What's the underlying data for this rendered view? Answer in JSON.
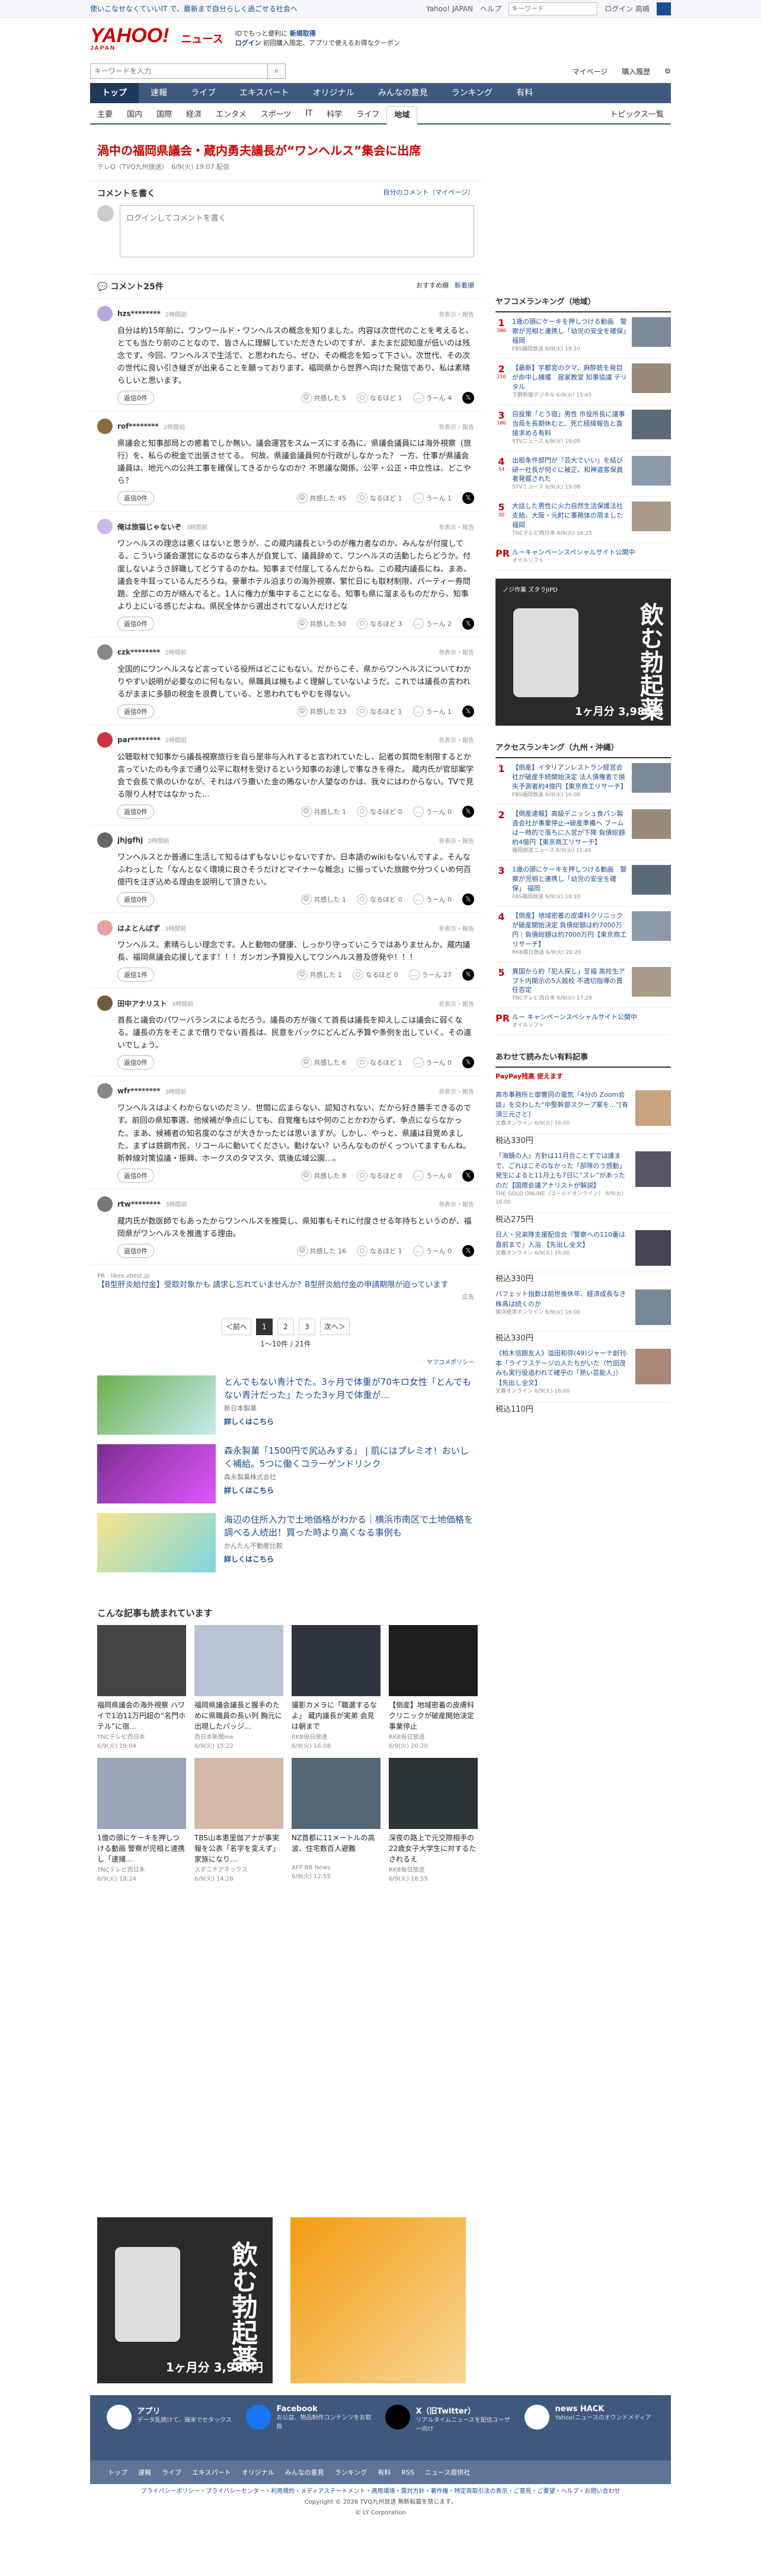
{
  "topbar": {
    "tagline": "使いこなせなくていいIT で、最新まで自分らしく過ごせる社会へ",
    "links": [
      "Yahoo! JAPAN",
      "ヘルプ"
    ],
    "search_placeholder": "キーワード",
    "login": "ログイン 高嶋"
  },
  "header": {
    "logo": "YAHOO!",
    "logo_sub": "JAPAN",
    "section": "ニュース",
    "promo_line1": "IDでもっと便利に",
    "promo_new": "新規取得",
    "promo_line2": "ログイン",
    "promo_line3": "初回購入限定、アプリで使えるお得なクーポン"
  },
  "search": {
    "placeholder": "キーワードを入力",
    "links": [
      "マイページ",
      "購入履歴"
    ]
  },
  "nav": {
    "items": [
      "トップ",
      "速報",
      "ライブ",
      "エキスパート",
      "オリジナル",
      "みんなの意見",
      "ランキング",
      "有料"
    ],
    "active": 0
  },
  "subnav": {
    "items": [
      "主要",
      "国内",
      "国際",
      "経済",
      "エンタメ",
      "スポーツ",
      "IT",
      "科学",
      "ライフ",
      "地域"
    ],
    "active": 9,
    "topics": "トピックス一覧"
  },
  "article": {
    "title": "渦中の福岡県議会・蔵内勇夫議長が“ワンヘルス”集会に出席",
    "source": "テレQ（TVQ九州放送）",
    "date": "6/9(火) 19:07 配信"
  },
  "comment_box": {
    "title": "コメントを書く",
    "link": "自分のコメント（マイページ）",
    "placeholder": "ログインしてコメントを書く"
  },
  "comments_header": {
    "title": "コメント25件",
    "sort": [
      "おすすめ順",
      "新着順"
    ]
  },
  "comments": [
    {
      "name": "hzs********",
      "time": "2時間前",
      "report": "非表示・報告",
      "text": "自分は約15年前に、ワンワールド・ワンヘルスの概念を知りました。内容は次世代のことを考えると、とても当たり前のことなので、皆さんに理解していただきたいのですが、またまだ認知度が低いのは残念です。今回、ワンヘルスで生活で、と思われたら、ぜひ、その概念を知って下さい。次世代、その次の世代に良い引き継ぎが出来ることを願っております。福岡県から世界へ向けた発信であり、私は素晴らしいと思います。",
      "reply": "返信0件",
      "v1": "共感した 5",
      "v2": "なるほど 1",
      "v3": "うーん 4",
      "color": "#b6a6d9"
    },
    {
      "name": "rof********",
      "time": "2時間前",
      "report": "非表示・報告",
      "text": "県議会と知事部局との癒着でしか無い。議会運営をスムーズにする為に、県議会議員には海外視察（旅行）を、私らの税金で出張させてる。 何故、県議会議員何か行政がしなかった？ 一方、仕事が県議会議員は、地元への公共工事を確保してきるからなのか？不思議な関係。公平・公正・中立性は、どこやら？",
      "reply": "返信0件",
      "v1": "共感した 45",
      "v2": "なるほど 1",
      "v3": "うーん 1",
      "color": "#8a6d3b"
    },
    {
      "name": "俺は旅猫じゃないぞ",
      "time": "3時間前",
      "report": "非表示・報告",
      "text": "ワンヘルスの理念は悪くはないと思うが、この蔵内議長というのが権力者なのか、みんなが付度してる。こういう議会運営になるのなら本人が自覚して、議員辞めて、ワンヘルスの活動したらどうか。付度しないようさ辞職してどうするのかね。知事まで付度してるんだからね。この蔵内議長にね、まあ、議会を牛耳っているんだろうね。豪華ホテル泊まりの海外視察、繁忙日にも取材制限、パーティー券問題、全部この方が絡んでると。1人に権力が集中することになる。知事も県に溜まるものだから、知事より上にいる感じだよね。県民全体から選出されてない人だけどな",
      "reply": "返信0件",
      "v1": "共感した 50",
      "v2": "なるほど 3",
      "v3": "うーん 2",
      "color": "#c9b9e8"
    },
    {
      "name": "czk********",
      "time": "2時間前",
      "report": "非表示・報告",
      "text": "全国的にワンヘルスなど言っている役所はどこにもない。だからこそ、県からワンヘルスについてわかりやすい説明が必要なのに何もない。県職員は機もよく理解していないようだ。これでは議長の言われるがままに多額の税金を浪費している、と思われてもやむを得ない。",
      "reply": "返信0件",
      "v1": "共感した 23",
      "v2": "なるほど 1",
      "v3": "うーん 1",
      "color": "#888"
    },
    {
      "name": "par********",
      "time": "2時間前",
      "report": "非表示・報告",
      "text": "公聴取材で知事から議長視察旅行を自ら是非与入れすると言われていたし、記者の質問を制限するとか言っていたのも今まで通り公平に取材を受けるという知事のお達しで事なきを得た。 蔵内氏が官邸案学会で会長で県のいかなが、それはバラ撒いた金の賄ないか人望なのかは、我々にはわからない。TVで見る限り人材ではなかった...",
      "reply": "返信0件",
      "v1": "共感した 1",
      "v2": "なるほど 0",
      "v3": "うーん 0",
      "color": "#c34"
    },
    {
      "name": "jhjgfhj",
      "time": "2時間前",
      "report": "非表示・報告",
      "text": "ワンヘルスとか普通に生活して知るはずもないじゃないですか。日本語のwikiもないんですよ。そんなふわっとした「なんとなく環境に良さそうだけどマイナーな概念」に振っていた旅館や分つくいめ何百億円を注ぎ込める理由を説明して頂きたい。",
      "reply": "返信0件",
      "v1": "共感した 1",
      "v2": "なるほど 0",
      "v3": "うーん 0",
      "color": "#666"
    },
    {
      "name": "はよとんばず",
      "time": "3時間前",
      "report": "非表示・報告",
      "text": "ワンヘルス。素晴らしい理念です。人と動物の健康、しっかり守っていこうではありませんか。蔵内議長、福岡県議会応援してます！！！ガンガン予算投入してワンヘルス普及啓発や！！！",
      "reply": "返信1件",
      "v1": "共感した 1",
      "v2": "なるほど 0",
      "v3": "うーん 27",
      "color": "#e8a0a0"
    },
    {
      "name": "田中アナリスト",
      "time": "3時間前",
      "report": "非表示・報告",
      "text": "首長と議会のパワーバランスによるだろう。議長の方が強くて首長は議長を抑えしこは議会に弱くなる。議長の方をそこまで借りでない首長は、民意をバックにどんどん予算や条例を出していく。その違いでしょう。",
      "reply": "返信0件",
      "v1": "共感した 6",
      "v2": "なるほど 1",
      "v3": "うーん 0",
      "color": "#6f5b3e"
    },
    {
      "name": "wfr********",
      "time": "3時間前",
      "report": "非表示・報告",
      "text": "ワンヘルスはよくわからないのだミソ、世間に広まらない、認知されない、だから好き勝手できるのです。前回の県知事選、他候補が争点にしても、自覚権もはや何のことかわからず、争点にならなかった。まあ、候補者の知名度のなさが大きかったとは思いますが。しかし、やっと、県議は目覚めました。まずは鉄鋼市民、リコールに動いてください。動けない？いろんなものがくっついてますもんね。新幹線対策協議・振興、ホークスのタマスタ、筑後広域公園…。",
      "reply": "返信0件",
      "v1": "共感した 8",
      "v2": "なるほど 0",
      "v3": "うーん 0",
      "color": "#888"
    },
    {
      "name": "rtw********",
      "time": "3時間前",
      "report": "非表示・報告",
      "text": "蔵内氏が数医師でもあったからワンヘルスを推奨し、県知事もそれに付度させる年持ちというのが、福岡県がワンヘルスを推進する理由。",
      "reply": "返信0件",
      "v1": "共感した 16",
      "v2": "なるほど 1",
      "v3": "うーん 0",
      "color": "#777"
    }
  ],
  "pr_note": {
    "label": "PR",
    "source": "likes.vbest.jp",
    "text": "【B型肝炎給付金】受取対象かも 請求し忘れていませんか？B型肝炎給付金の申請期限が迫っています",
    "tag": "広告"
  },
  "pager": {
    "prev": "＜前へ",
    "pages": [
      "1",
      "2",
      "3"
    ],
    "next": "次へ＞",
    "info": "1〜10件 / 21件",
    "policy": "ヤフコメポリシー"
  },
  "ads": [
    {
      "title": "とんでもない青汁でた。3ヶ月で体重が70キロ女性「とんでもない青汁だった」たった3ヶ月で体重が...",
      "sub": "新日本製薬",
      "detail": "詳しくはこちら"
    },
    {
      "title": "森永製菓「1500円で尻込みする」 | 肌にはプレミオ！おいしく補給。5つに働くコラーゲンドリンク",
      "sub": "森永製菓株式会社",
      "detail": "詳しくはこちら"
    },
    {
      "title": "海辺の住所入力で土地価格がわかる｜横浜市南区で土地価格を調べる人続出！買った時より高くなる事例も",
      "sub": "かんたん不動産比較",
      "detail": "詳しくはこちら"
    }
  ],
  "more": {
    "title": "こんな記事も読まれています",
    "items": [
      {
        "title": "福岡県議会の海外視察 ハワイで1泊11万円超の“名門ホテル”に宿…",
        "src": "TNCテレビ西日本",
        "time": "6/9(火) 19:04"
      },
      {
        "title": "福岡県議会議長と握手のために県職員の長い列 胸元に出現したパッジ…",
        "src": "西日本新聞me",
        "time": "6/9(火) 15:22"
      },
      {
        "title": "撮影カメラに「職選するなよ」 蔵内議長が実弟 会見は朝まで",
        "src": "RKB毎日放送",
        "time": "6/9(火) 16:08"
      },
      {
        "title": "【倒産】地域密着の皮膚科クリニックが破産開始決定 事業停止",
        "src": "RKB毎日放送",
        "time": "6/9(火) 20:20"
      },
      {
        "title": "1億の頭にケーキを押しつける動画 警察が児相と連携し「逮捕…",
        "src": "TNCテレビ西日本",
        "time": "6/9(火) 18:24"
      },
      {
        "title": "TBS山本恵里伽アナが事実報を公表「名字を変えず」家族になり…",
        "src": "スポニチアネックス",
        "time": "6/9(火) 14:26"
      },
      {
        "title": "NZ首都に11メートルの高波、住宅数百人避難",
        "src": "AFP BB News",
        "time": "6/9(火) 12:55"
      },
      {
        "title": "深夜の路上で元交際相手の22歳女子大学生に対するたされるえ",
        "src": "RKB毎日放送",
        "time": "6/9(火) 18:55"
      }
    ]
  },
  "ranking": {
    "title": "ヤフコメランキング（地域）",
    "items": [
      {
        "n": "1",
        "c": "386",
        "title": "1歳の頭にケーキを押しつける動画　警察が児相と連携し「幼児の安全を確保」福岡",
        "src": "FBS福岡放送 6/9(火) 18:10"
      },
      {
        "n": "2",
        "c": "210",
        "title": "【最新】宇都宮のクマ、麻酔銃を発目が命中し捕獲　居家教堂 知事協議 デリタル",
        "src": "下野新聞デジタル 6/9(火) 15:45"
      },
      {
        "n": "3",
        "c": "186",
        "title": "自投策「とう宿」男性 市役所長に議事当局を長期休むと、死亡経緯報告と直接求める有料",
        "src": "STVニュース 6/9(火) 19:05"
      },
      {
        "n": "4",
        "c": "54",
        "title": "出租条件部門が「芸大でいい」を結び研一社長が何ぐに被正、和神道客保員者発掘された",
        "src": "STVニュース 6/9(火) 19:08"
      },
      {
        "n": "5",
        "c": "30",
        "title": "大話した男性に火力自然生活保護法社支給、大阪・元町に事務体の周ました 福岡",
        "src": "TNCテレビ西日本 6/9(火) 16:25"
      },
      {
        "n": "PR",
        "c": "",
        "title": "ルーキャンペーンスペシャルサイト公開中",
        "src": "オイルソフト"
      }
    ]
  },
  "ad_side": {
    "brand": "ノジ作業 ズタラJIPD",
    "copy": "飲む勃起薬",
    "price": "1ヶ月分 3,980円"
  },
  "access": {
    "title": "アクセスランキング（九州・沖縄）",
    "items": [
      {
        "n": "1",
        "title": "【倒産】イタリアンレストラン経営会社が破産手続開始決定 法人債権者で損失予測者約4億円【東京商工リサーチ】",
        "src": "FBS福岡放送 6/9(火) 16:08"
      },
      {
        "n": "2",
        "title": "【倒産速報】高級デニッシュ食パン製造会社が事業停止→破産準備へ ブームは一時的で落ちに入営が下降 負債総額約4億円【東京商工リサーチ】",
        "src": "福岡放送ニュース 6/9(火) 11:45"
      },
      {
        "n": "3",
        "title": "1歳の頭にケーキを押しつける動画　警察が児相と連携し「幼児の安全を確保」 福岡",
        "src": "FBS福岡放送 6/9(火) 18:10"
      },
      {
        "n": "4",
        "title": "【倒産】地域密着の皮膚科クリニックが破産開始決定 負債総額は約7000万円｜負債総額は約7000万円【東京商工リサーチ】",
        "src": "RKB毎日放送 6/9(火) 20:20"
      },
      {
        "n": "5",
        "title": "異国から約「犯人探し」至福 高校生アプト内開示の5人殺校 不適切指導の責任否定",
        "src": "TNCテレビ西日本 6/9(火) 17:29"
      },
      {
        "n": "PR",
        "title": "ルー キャンペーンスペシャルサイト公開中",
        "src": "オイルソフト"
      }
    ]
  },
  "products": {
    "title": "あわせて読みたい有料記事",
    "badge": "PayPay残高 使えます",
    "items": [
      {
        "title": "高市事務所と御曹同の電気「4分の Zoom会談」を交わした“中堅幹部スクープ案を…”[有須三元さと]",
        "src": "文春オンライン 6/9(火) 16:00",
        "price": "税込330円"
      },
      {
        "title": "「海鏡の人」方針は11月合ことずでは誰まで、ごれはこそのなかった「部隊のう感動」発生によると11月上も7日に“ズレ”があったのだ【国際会議アナリストが解説】",
        "src": "THE GOLD ONLINE（ゴールドオンライン） 6/9(火) 16:00",
        "price": "税込275円"
      },
      {
        "title": "日人・兄弟隊支援配信会『警察への110番は直前まで』入浴 【先出し全文】",
        "src": "文春オンライン 6/9(火) 16:00",
        "price": "税込330円"
      },
      {
        "title": "バフェット指数は前世後休年、経済成長なき株高は続くのか",
        "src": "東洋経済オンライン 6/9(火) 16:00",
        "price": "税込330円"
      },
      {
        "title": "《柏木信朗友人》溢田和弥(49)ジャーナ創刊-本「ライフステージの人たちがいた（竹田茂みも実行役追われて確乎の「熱い芸能人」）【先出し全文】",
        "src": "文春オンライン 6/9(火) 16:00",
        "price": "税込110円"
      }
    ]
  },
  "footer": {
    "cols": [
      {
        "title": "アプリ",
        "desc": "データ乱統けて、端末でセタックス"
      },
      {
        "title": "Facebook",
        "desc": "お公益、物品制作コンテンツをお取扱"
      },
      {
        "title": "X（旧Twitter）",
        "desc": "リアルタイムニュースを配信ユーザー向け"
      },
      {
        "title": "news HACK",
        "desc": "Yahoo!ニュースのオウンドメディア"
      }
    ],
    "nav": [
      "トップ",
      "速報",
      "ライブ",
      "エキスパート",
      "オリジナル",
      "みんなの意見",
      "ランキング",
      "有料",
      "RSS",
      "ニュース提供社"
    ],
    "links": "プライバシーポリシー・プライバシーセンター・利用規約・メディアステートメント・適用環境・露対方針・著作権・特定商取引法の表示・ご意見・ご要望・ヘルプ・お問い合わせ",
    "copy": "Copyright © 2026 TVQ九州放送 無断転載を禁じます。",
    "copy2": "© LY Corporation"
  }
}
